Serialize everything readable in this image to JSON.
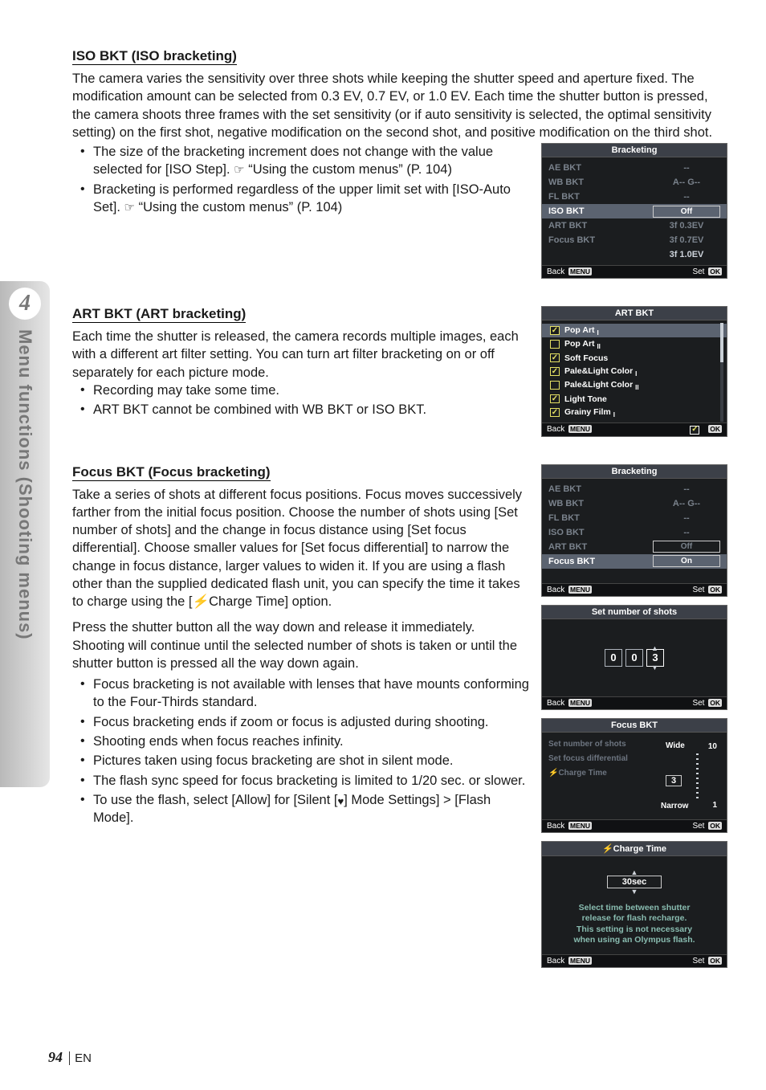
{
  "side": {
    "chapter": "4",
    "label": "Menu functions (Shooting menus)"
  },
  "footer": {
    "page": "94",
    "lang": "EN"
  },
  "ref_icon": "☞",
  "iso": {
    "title": "ISO BKT (ISO bracketing)",
    "para": "The camera varies the sensitivity over three shots while keeping the shutter speed and aperture fixed. The modification amount can be selected from 0.3 EV, 0.7 EV, or 1.0 EV. Each time the shutter button is pressed, the camera shoots three frames with the set sensitivity (or if auto sensitivity is selected, the optimal sensitivity setting) on the first shot, negative modification on the second shot, and positive modification on the third shot.",
    "bullets": [
      {
        "pre": "The size of the bracketing increment does not change with the value selected for [ISO Step]. ",
        "ref": "“Using the custom menus” (P. 104)"
      },
      {
        "pre": "Bracketing is performed regardless of the upper limit set with [ISO-Auto Set]. ",
        "ref": "“Using the custom menus” (P. 104)"
      }
    ]
  },
  "art": {
    "title": "ART BKT (ART bracketing)",
    "para": "Each time the shutter is released, the camera records multiple images, each with a different art filter setting. You can turn art filter bracketing on or off separately for each picture mode.",
    "bullets": [
      "Recording may take some time.",
      "ART BKT cannot be combined with WB BKT or ISO BKT."
    ]
  },
  "focus": {
    "title": "Focus BKT (Focus bracketing)",
    "para1": "Take a series of shots at different focus positions. Focus moves successively farther from the initial focus position. Choose the number of shots using [Set number of shots] and the change in focus distance using [Set focus differential]. Choose smaller values for [Set focus differential] to narrow the change in focus distance, larger values to widen it. If you are using a flash other than the supplied dedicated flash unit, you can specify the time it takes to charge using the [",
    "para1_end": "Charge Time] option.",
    "para2": "Press the shutter button all the way down and release it immediately. Shooting will continue until the selected number of shots is taken or until the shutter button is pressed all the way down again.",
    "bullets": [
      "Focus bracketing is not available with lenses that have mounts conforming to the Four-Thirds standard.",
      "Focus bracketing ends if zoom or focus is adjusted during shooting.",
      "Shooting ends when focus reaches infinity.",
      "Pictures taken using focus bracketing are shot in silent mode.",
      "The flash sync speed for focus bracketing is limited to 1/20 sec. or slower.",
      "To use the flash, select [Allow] for [Silent [♥] Mode Settings] > [Flash Mode]."
    ]
  },
  "screens": {
    "bracketing1": {
      "title": "Bracketing",
      "rows": [
        {
          "label": "AE BKT",
          "value": "--",
          "dim": true
        },
        {
          "label": "WB BKT",
          "value": "A-- G--",
          "dim": true
        },
        {
          "label": "FL BKT",
          "value": "--",
          "dim": true
        },
        {
          "label": "ISO BKT",
          "value": "Off",
          "box": true,
          "hl": true
        },
        {
          "label": "ART BKT",
          "value": "3f 0.3EV",
          "dim": true
        },
        {
          "label": "Focus BKT",
          "value": "3f 0.7EV",
          "dim": true
        },
        {
          "label": "",
          "value": "3f 1.0EV",
          "dim": false
        }
      ],
      "footer_left": "Back",
      "footer_left_tag": "MENU",
      "footer_right": "Set",
      "footer_right_tag": "OK"
    },
    "artbkt": {
      "title": "ART BKT",
      "items": [
        {
          "label": "Pop Art",
          "suffix": "I",
          "checked": true,
          "hl": true
        },
        {
          "label": "Pop Art",
          "suffix": "II",
          "checked": false
        },
        {
          "label": "Soft Focus",
          "suffix": "",
          "checked": true
        },
        {
          "label": "Pale&Light Color",
          "suffix": "I",
          "checked": true
        },
        {
          "label": "Pale&Light Color",
          "suffix": "II",
          "checked": false
        },
        {
          "label": "Light Tone",
          "suffix": "",
          "checked": true
        },
        {
          "label": "Grainy Film",
          "suffix": "I",
          "checked": true
        }
      ],
      "footer_left": "Back",
      "footer_left_tag": "MENU",
      "footer_right_tag": "OK"
    },
    "bracketing2": {
      "title": "Bracketing",
      "rows": [
        {
          "label": "AE BKT",
          "value": "--",
          "dim": true
        },
        {
          "label": "WB BKT",
          "value": "A-- G--",
          "dim": true
        },
        {
          "label": "FL BKT",
          "value": "--",
          "dim": true
        },
        {
          "label": "ISO BKT",
          "value": "--",
          "dim": true
        },
        {
          "label": "ART BKT",
          "value": "Off",
          "dim": true,
          "box": true
        },
        {
          "label": "Focus BKT",
          "value": "On",
          "hl": true,
          "box": true
        }
      ],
      "footer_left": "Back",
      "footer_left_tag": "MENU",
      "footer_right": "Set",
      "footer_right_tag": "OK"
    },
    "shots": {
      "title": "Set number of shots",
      "digits": [
        "0",
        "0",
        "3"
      ],
      "footer_left": "Back",
      "footer_left_tag": "MENU",
      "footer_right": "Set",
      "footer_right_tag": "OK"
    },
    "focusbkt": {
      "title": "Focus BKT",
      "items": [
        "Set number of shots",
        "Set focus differential",
        "Charge Time"
      ],
      "wide": "Wide",
      "narrow": "Narrow",
      "top_num": "10",
      "bot_num": "1",
      "mid": "3",
      "footer_left": "Back",
      "footer_left_tag": "MENU",
      "footer_right": "Set",
      "footer_right_tag": "OK"
    },
    "charge": {
      "title": "Charge Time",
      "value": "30sec",
      "desc": [
        "Select time between shutter",
        "release for flash recharge.",
        "This setting is not necessary",
        "when using an Olympus flash."
      ],
      "footer_left": "Back",
      "footer_left_tag": "MENU",
      "footer_right": "Set",
      "footer_right_tag": "OK"
    }
  }
}
